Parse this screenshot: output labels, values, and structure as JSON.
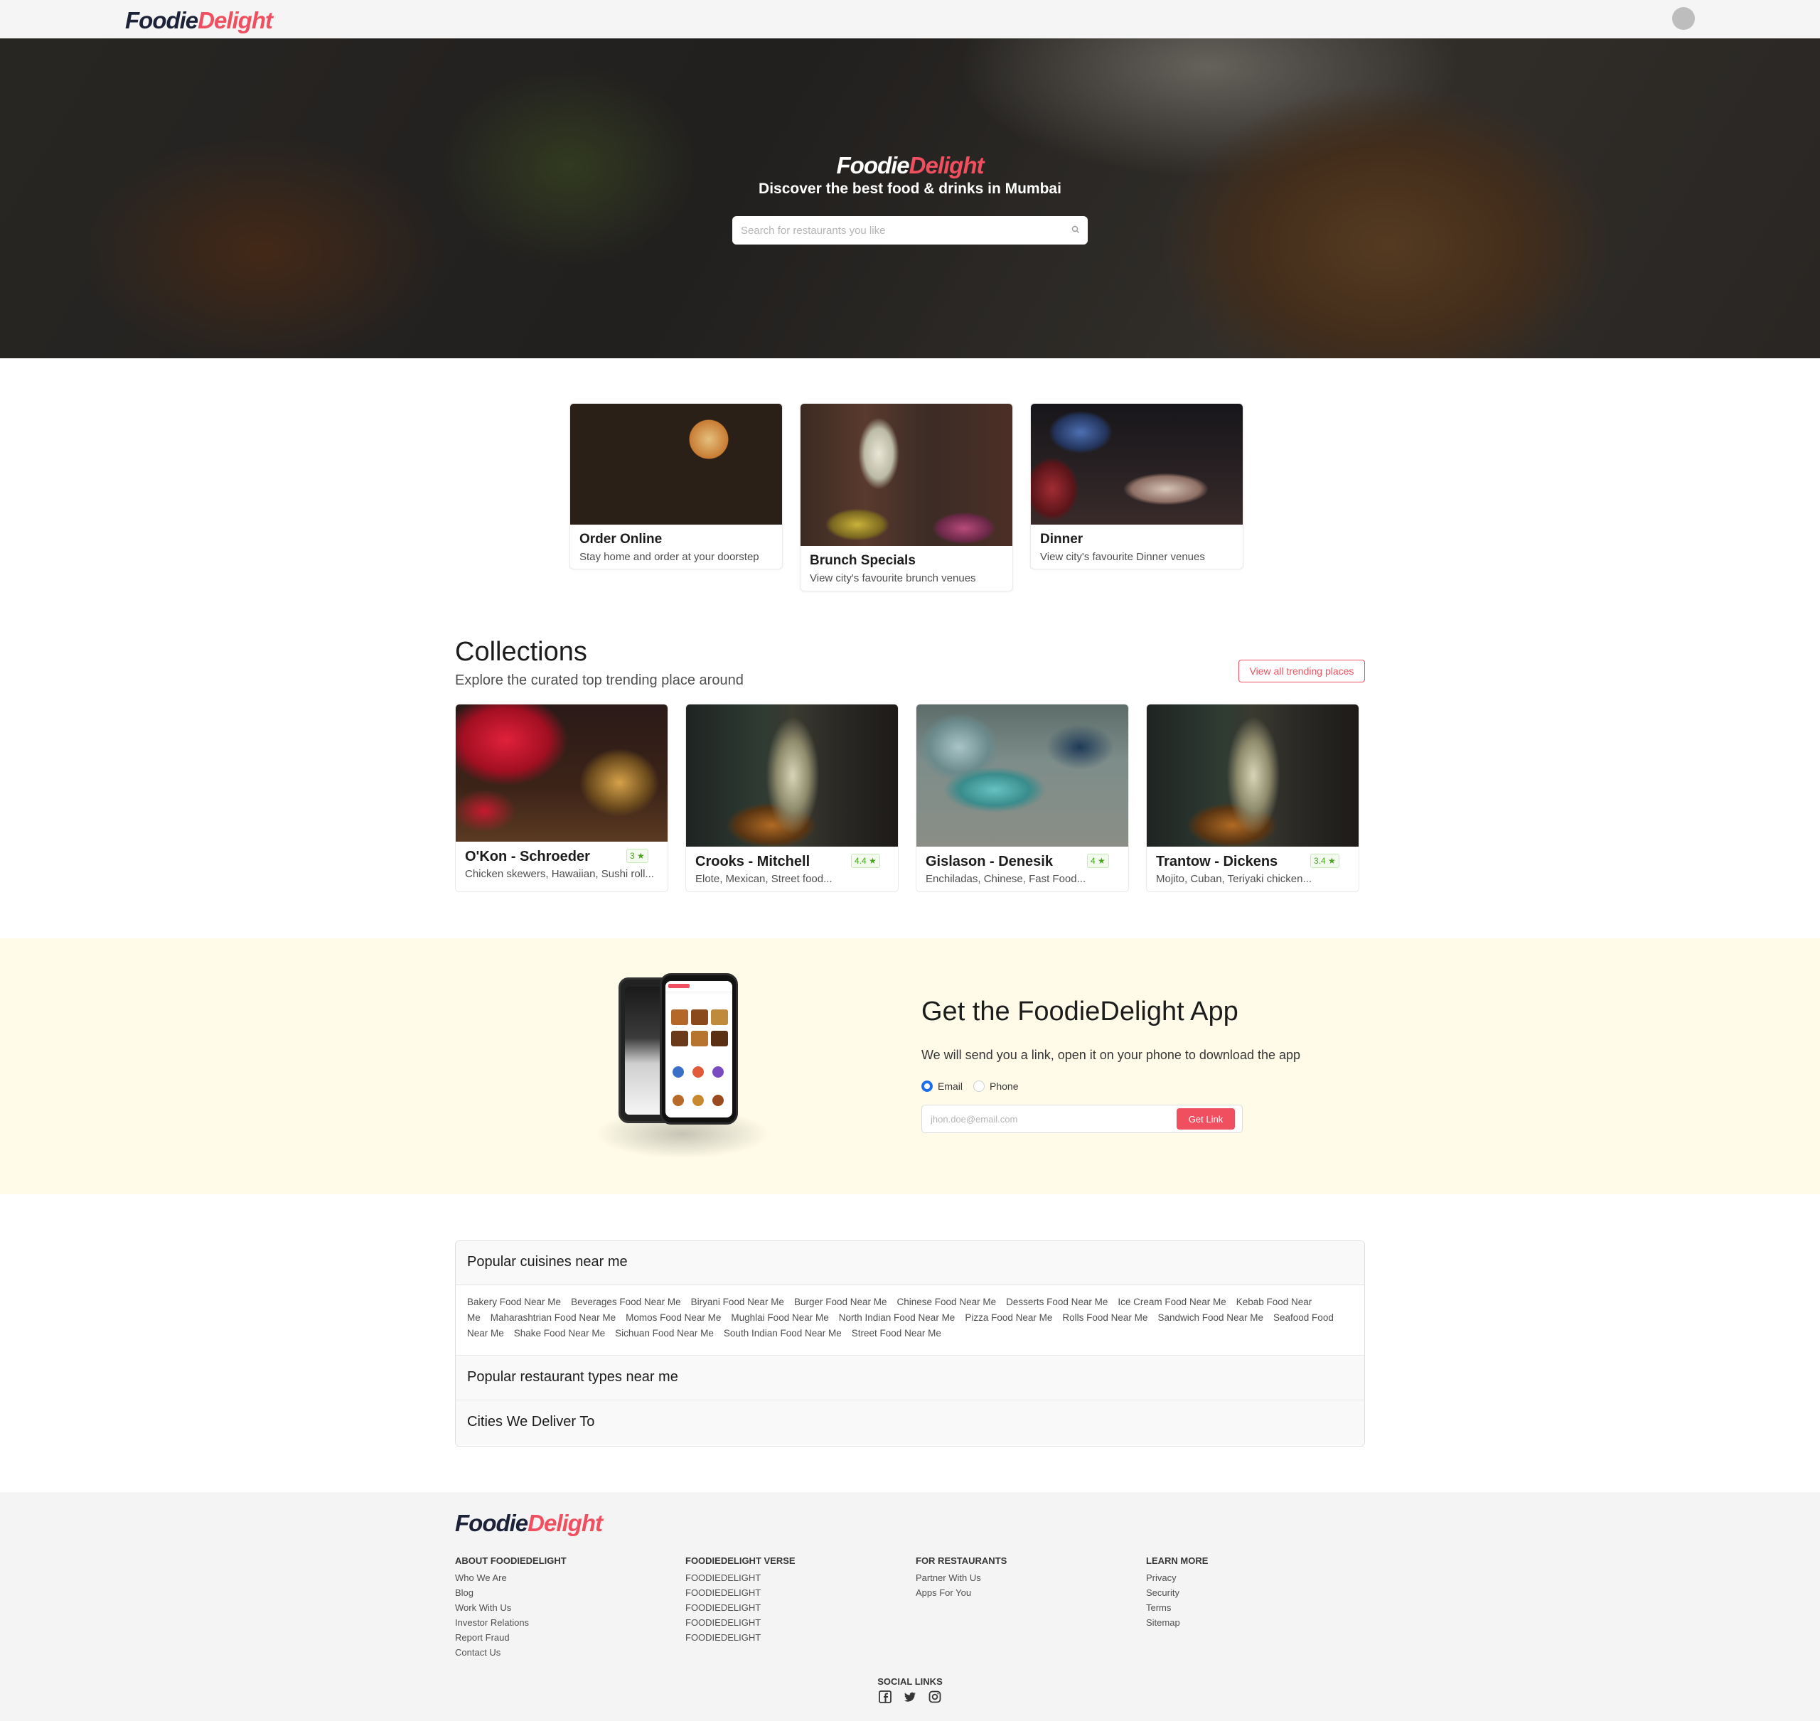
{
  "brand": {
    "part1": "Foodie",
    "part2": "Delight"
  },
  "hero": {
    "tagline": "Discover the best food & drinks in Mumbai",
    "search_placeholder": "Search for restaurants you like"
  },
  "categories": [
    {
      "title": "Order Online",
      "subtitle": "Stay home and order at your doorstep"
    },
    {
      "title": "Brunch Specials",
      "subtitle": "View city's favourite brunch venues"
    },
    {
      "title": "Dinner",
      "subtitle": "View city's favourite Dinner venues"
    }
  ],
  "collections": {
    "title": "Collections",
    "subtitle": "Explore the curated top trending place around",
    "view_all_label": "View all trending places",
    "items": [
      {
        "name": "O'Kon - Schroeder",
        "cuisine": "Chicken skewers, Hawaiian, Sushi roll...",
        "rating": "3"
      },
      {
        "name": "Crooks - Mitchell",
        "cuisine": "Elote, Mexican, Street food...",
        "rating": "4.4"
      },
      {
        "name": "Gislason - Denesik",
        "cuisine": "Enchiladas, Chinese, Fast Food...",
        "rating": "4"
      },
      {
        "name": "Trantow - Dickens",
        "cuisine": "Mojito, Cuban, Teriyaki chicken...",
        "rating": "3.4"
      }
    ]
  },
  "app": {
    "title": "Get the FoodieDelight App",
    "subtitle": "We will send you a link, open it on your phone to download the app",
    "option_email": "Email",
    "option_phone": "Phone",
    "selected_option": "Email",
    "email_placeholder": "jhon.doe@email.com",
    "button_label": "Get Link"
  },
  "accordion": {
    "sections": [
      {
        "title": "Popular cuisines near me",
        "expanded": true
      },
      {
        "title": "Popular restaurant types near me",
        "expanded": false
      },
      {
        "title": "Cities We Deliver To",
        "expanded": false
      }
    ],
    "cuisine_links": [
      "Bakery Food Near Me",
      "Beverages Food Near Me",
      "Biryani Food Near Me",
      "Burger Food Near Me",
      "Chinese Food Near Me",
      "Desserts Food Near Me",
      "Ice Cream Food Near Me",
      "Kebab Food Near Me",
      "Maharashtrian Food Near Me",
      "Momos Food Near Me",
      "Mughlai Food Near Me",
      "North Indian Food Near Me",
      "Pizza Food Near Me",
      "Rolls Food Near Me",
      "Sandwich Food Near Me",
      "Seafood Food Near Me",
      "Shake Food Near Me",
      "Sichuan Food Near Me",
      "South Indian Food Near Me",
      "Street Food Near Me"
    ]
  },
  "footer": {
    "columns": [
      {
        "heading": "ABOUT FOODIEDELIGHT",
        "links": [
          "Who We Are",
          "Blog",
          "Work With Us",
          "Investor Relations",
          "Report Fraud",
          "Contact Us"
        ]
      },
      {
        "heading": "FOODIEDELIGHT VERSE",
        "links": [
          "FOODIEDELIGHT",
          "FOODIEDELIGHT",
          "FOODIEDELIGHT",
          "FOODIEDELIGHT",
          "FOODIEDELIGHT"
        ]
      },
      {
        "heading": "FOR RESTAURANTS",
        "links": [
          "Partner With Us",
          "Apps For You"
        ]
      },
      {
        "heading": "LEARN MORE",
        "links": [
          "Privacy",
          "Security",
          "Terms",
          "Sitemap"
        ]
      }
    ],
    "social_heading": "SOCIAL LINKS",
    "social_icons": [
      "facebook-icon",
      "twitter-icon",
      "instagram-icon"
    ]
  },
  "colors": {
    "brand_red": "#ef4f5f",
    "brand_dark": "#1c2238",
    "rating_green": "#48a51d",
    "app_section_bg": "#fffbe8",
    "footer_bg": "#f4f4f4"
  }
}
